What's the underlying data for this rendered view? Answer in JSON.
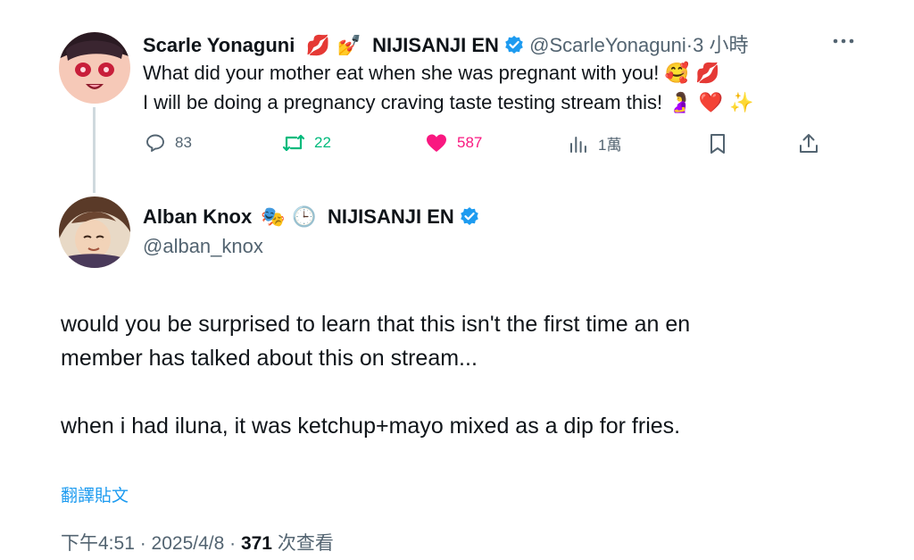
{
  "original_tweet": {
    "author_name": "Scarle Yonaguni",
    "author_emojis": "💋 💅",
    "affiliation": "NIJISANJI EN",
    "handle": "@ScarleYonaguni",
    "time": "3 小時",
    "line1": "What did your mother eat when she was pregnant with you!",
    "line1_emojis": "🥰 💋",
    "line2": "I will be doing a pregnancy craving taste testing stream this!",
    "line2_emojis": "🤰 ❤️ ✨",
    "replies": "83",
    "reposts": "22",
    "likes": "587",
    "views": "1萬",
    "colors": {
      "repost": "#00ba7c",
      "like": "#f91880",
      "verified": "#1d9bf0"
    }
  },
  "reply_tweet": {
    "author_name": "Alban Knox",
    "author_emojis": "🎭 🕒",
    "affiliation": "NIJISANJI EN",
    "handle": "@alban_knox",
    "paragraph1_line1": "would you be surprised to learn that this isn't the first time an en",
    "paragraph1_line2": "member has talked about this on stream...",
    "paragraph2": "when i had iluna, it was ketchup+mayo mixed as a dip for fries.",
    "translate_label": "翻譯貼文",
    "timestamp": "下午4:51 · 2025/4/8 · ",
    "view_count": "371",
    "view_label": " 次查看"
  }
}
